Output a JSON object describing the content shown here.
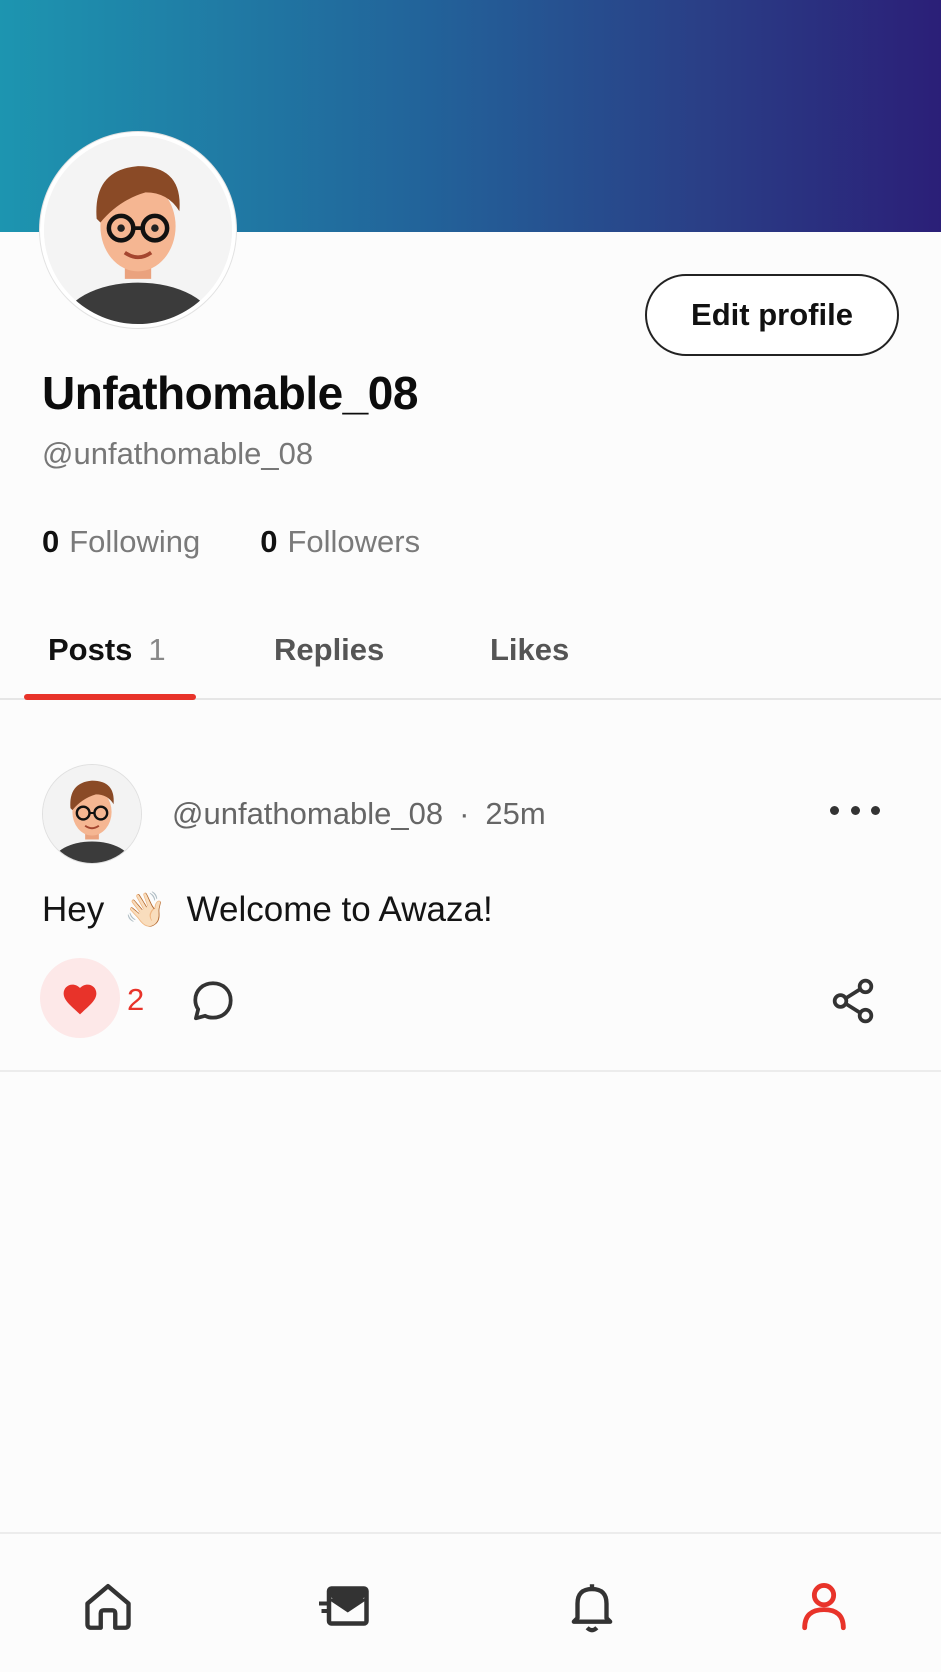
{
  "profile": {
    "display_name": "Unfathomable_08",
    "handle": "@unfathomable_08",
    "edit_button_label": "Edit profile",
    "following_count": "0",
    "following_label": "Following",
    "followers_count": "0",
    "followers_label": "Followers"
  },
  "tabs": [
    {
      "label": "Posts",
      "count": "1",
      "active": true
    },
    {
      "label": "Replies"
    },
    {
      "label": "Likes"
    }
  ],
  "post": {
    "author_handle": "@unfathomable_08",
    "separator": "·",
    "time": "25m",
    "text_before": "Hey",
    "emoji": "👋🏻",
    "text_after": "Welcome to Awaza!",
    "like_count": "2",
    "liked": true
  },
  "nav": [
    {
      "icon": "home-icon"
    },
    {
      "icon": "inbox-icon"
    },
    {
      "icon": "bell-icon"
    },
    {
      "icon": "profile-icon",
      "active": true
    }
  ],
  "colors": {
    "accent": "#e8332a",
    "banner_start": "#1d95b0",
    "banner_end": "#2b1f78"
  }
}
